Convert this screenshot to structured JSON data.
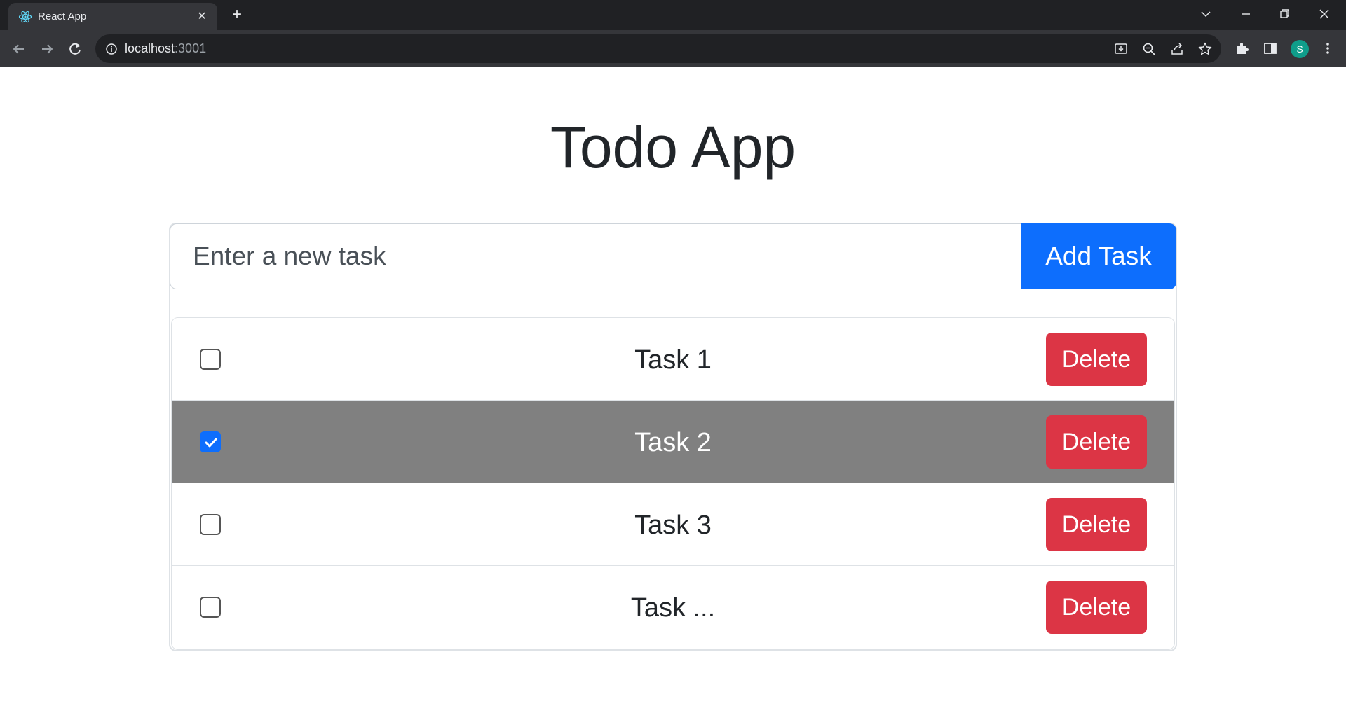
{
  "browser": {
    "tab_title": "React App",
    "tab_close": "✕",
    "new_tab": "+",
    "url_host": "localhost",
    "url_port": ":3001",
    "profile_initial": "S"
  },
  "app": {
    "title": "Todo App",
    "input_placeholder": "Enter a new task",
    "add_button": "Add Task"
  },
  "tasks": [
    {
      "label": "Task 1",
      "completed": false,
      "delete_label": "Delete"
    },
    {
      "label": "Task 2",
      "completed": true,
      "delete_label": "Delete"
    },
    {
      "label": "Task 3",
      "completed": false,
      "delete_label": "Delete"
    },
    {
      "label": "Task ...",
      "completed": false,
      "delete_label": "Delete"
    }
  ],
  "colors": {
    "primary": "#0d6efd",
    "danger": "#dc3545",
    "completed_row": "#808080",
    "chrome_dark": "#202124"
  }
}
